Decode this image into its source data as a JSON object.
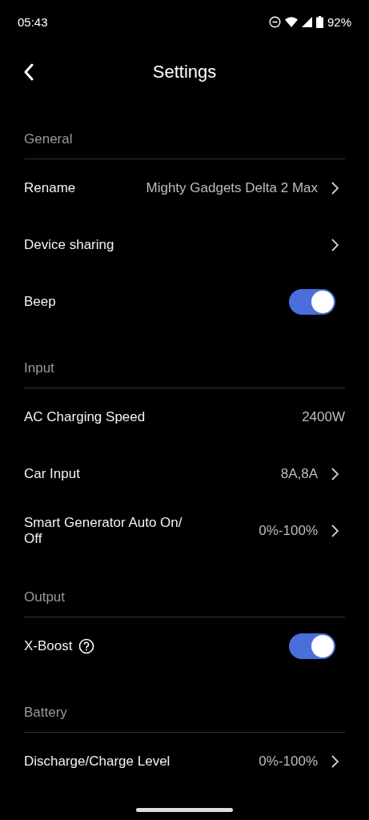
{
  "status_bar": {
    "time": "05:43",
    "battery": "92%"
  },
  "header": {
    "title": "Settings"
  },
  "sections": [
    {
      "title": "General",
      "items": [
        {
          "kind": "link",
          "label": "Rename",
          "value": "Mighty Gadgets Delta 2 Max"
        },
        {
          "kind": "link",
          "label": "Device sharing"
        },
        {
          "kind": "toggle",
          "label": "Beep",
          "on": true
        }
      ]
    },
    {
      "title": "Input",
      "items": [
        {
          "kind": "info",
          "label": "AC Charging Speed",
          "value": "2400W"
        },
        {
          "kind": "link",
          "label": "Car Input",
          "value": "8A,8A"
        },
        {
          "kind": "link",
          "label": "Smart Generator Auto On/ Off",
          "value": "0%-100%"
        }
      ]
    },
    {
      "title": "Output",
      "items": [
        {
          "kind": "toggle",
          "label": "X-Boost",
          "help": true,
          "on": true
        }
      ]
    },
    {
      "title": "Battery",
      "items": [
        {
          "kind": "link",
          "label": "Discharge/Charge Level",
          "value": "0%-100%"
        }
      ]
    }
  ]
}
